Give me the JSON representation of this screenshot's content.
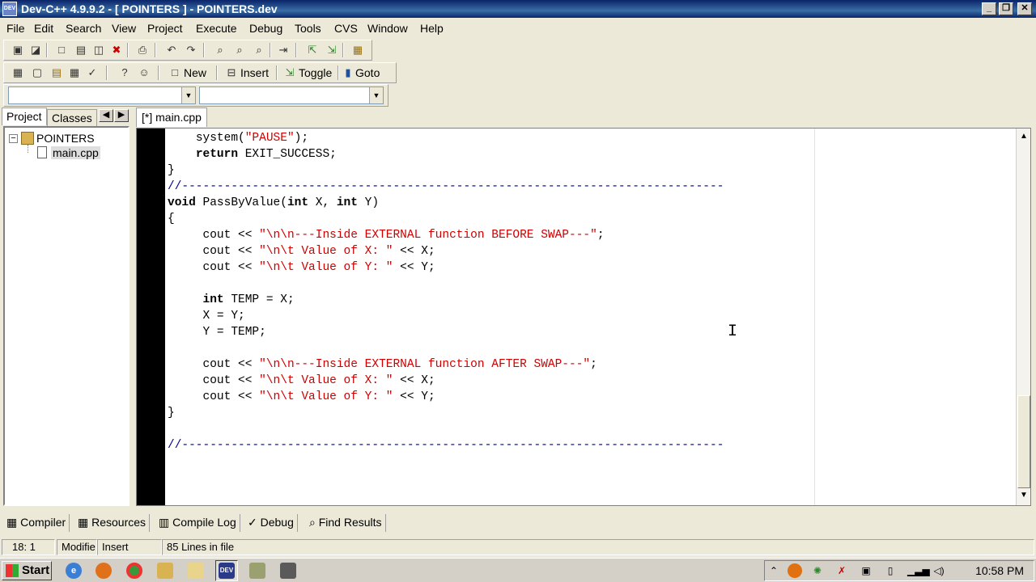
{
  "window": {
    "title": "Dev-C++ 4.9.9.2  - [ POINTERS ] - POINTERS.dev",
    "app_icon_label": "DEV",
    "minimize": "_",
    "maximize": "❐",
    "close": "✕"
  },
  "menu": [
    "File",
    "Edit",
    "Search",
    "View",
    "Project",
    "Execute",
    "Debug",
    "Tools",
    "CVS",
    "Window",
    "Help"
  ],
  "toolbar2": {
    "new_label": "New",
    "insert_label": "Insert",
    "toggle_label": "Toggle",
    "goto_label": "Goto"
  },
  "sidebar": {
    "tabs": [
      "Project",
      "Classes"
    ],
    "project_name": "POINTERS",
    "file_name": "main.cpp",
    "collapse_sign": "−",
    "scroll_left": "◀",
    "scroll_right": "▶"
  },
  "editor": {
    "tab_label": "[*] main.cpp",
    "code_lines": [
      {
        "i": 4,
        "parts": [
          {
            "t": "system(",
            "c": ""
          },
          {
            "t": "\"PAUSE\"",
            "c": "str"
          },
          {
            "t": ");",
            "c": ""
          }
        ]
      },
      {
        "i": 4,
        "parts": [
          {
            "t": "return",
            "c": "kw"
          },
          {
            "t": " EXIT_SUCCESS;",
            "c": ""
          }
        ]
      },
      {
        "i": 0,
        "parts": [
          {
            "t": "}",
            "c": ""
          }
        ]
      },
      {
        "i": 0,
        "parts": [
          {
            "t": "//-----------------------------------------------------------------------------",
            "c": "cmt"
          }
        ]
      },
      {
        "i": 0,
        "parts": [
          {
            "t": "void",
            "c": "kw"
          },
          {
            "t": " PassByValue(",
            "c": ""
          },
          {
            "t": "int",
            "c": "kw"
          },
          {
            "t": " X, ",
            "c": ""
          },
          {
            "t": "int",
            "c": "kw"
          },
          {
            "t": " Y)",
            "c": ""
          }
        ]
      },
      {
        "i": 0,
        "parts": [
          {
            "t": "{",
            "c": ""
          }
        ]
      },
      {
        "i": 5,
        "parts": [
          {
            "t": "cout << ",
            "c": ""
          },
          {
            "t": "\"\\n\\n---Inside EXTERNAL function BEFORE SWAP---\"",
            "c": "str"
          },
          {
            "t": ";",
            "c": ""
          }
        ]
      },
      {
        "i": 5,
        "parts": [
          {
            "t": "cout << ",
            "c": ""
          },
          {
            "t": "\"\\n\\t Value of X: \"",
            "c": "str"
          },
          {
            "t": " << X;",
            "c": ""
          }
        ]
      },
      {
        "i": 5,
        "parts": [
          {
            "t": "cout << ",
            "c": ""
          },
          {
            "t": "\"\\n\\t Value of Y: \"",
            "c": "str"
          },
          {
            "t": " << Y;",
            "c": ""
          }
        ]
      },
      {
        "i": 0,
        "parts": []
      },
      {
        "i": 5,
        "parts": [
          {
            "t": "int",
            "c": "kw"
          },
          {
            "t": " TEMP = X;",
            "c": ""
          }
        ]
      },
      {
        "i": 5,
        "parts": [
          {
            "t": "X = Y;",
            "c": ""
          }
        ]
      },
      {
        "i": 5,
        "parts": [
          {
            "t": "Y = TEMP;",
            "c": ""
          }
        ]
      },
      {
        "i": 0,
        "parts": []
      },
      {
        "i": 5,
        "parts": [
          {
            "t": "cout << ",
            "c": ""
          },
          {
            "t": "\"\\n\\n---Inside EXTERNAL function AFTER SWAP---\"",
            "c": "str"
          },
          {
            "t": ";",
            "c": ""
          }
        ]
      },
      {
        "i": 5,
        "parts": [
          {
            "t": "cout << ",
            "c": ""
          },
          {
            "t": "\"\\n\\t Value of X: \"",
            "c": "str"
          },
          {
            "t": " << X;",
            "c": ""
          }
        ]
      },
      {
        "i": 5,
        "parts": [
          {
            "t": "cout << ",
            "c": ""
          },
          {
            "t": "\"\\n\\t Value of Y: \"",
            "c": "str"
          },
          {
            "t": " << Y;",
            "c": ""
          }
        ]
      },
      {
        "i": 0,
        "parts": [
          {
            "t": "}",
            "c": ""
          }
        ]
      },
      {
        "i": 0,
        "parts": []
      },
      {
        "i": 0,
        "parts": [
          {
            "t": "//-----------------------------------------------------------------------------",
            "c": "cmt"
          }
        ]
      }
    ],
    "scroll_up": "▲",
    "scroll_down": "▼"
  },
  "bottom_tabs": [
    "Compiler",
    "Resources",
    "Compile Log",
    "Debug",
    "Find Results"
  ],
  "status": {
    "position": "18: 1",
    "modified": "Modifie",
    "mode": "Insert",
    "lines": "85 Lines in file"
  },
  "taskbar": {
    "start_label": "Start",
    "clock": "10:58 PM",
    "tray_expand": "⌃"
  },
  "icons": {
    "toolbar1": [
      "open-project-icon",
      "close-project-icon",
      "new-file-icon",
      "save-icon",
      "save-all-icon",
      "close-file-icon",
      "print-icon",
      "undo-icon",
      "redo-icon",
      "find-icon",
      "find-next-icon",
      "replace-icon",
      "goto-line-icon",
      "compile-icon",
      "run-icon",
      "rebuild-icon"
    ],
    "toolbar2": [
      "new-project-icon",
      "view-window-icon",
      "project-options-icon",
      "add-file-icon",
      "check-icon",
      "help-icon",
      "about-icon"
    ]
  },
  "colors": {
    "keyword": "#000000",
    "string": "#d00000",
    "comment": "#000090",
    "gutter": "#000000",
    "titlebar": "#0a246a"
  }
}
